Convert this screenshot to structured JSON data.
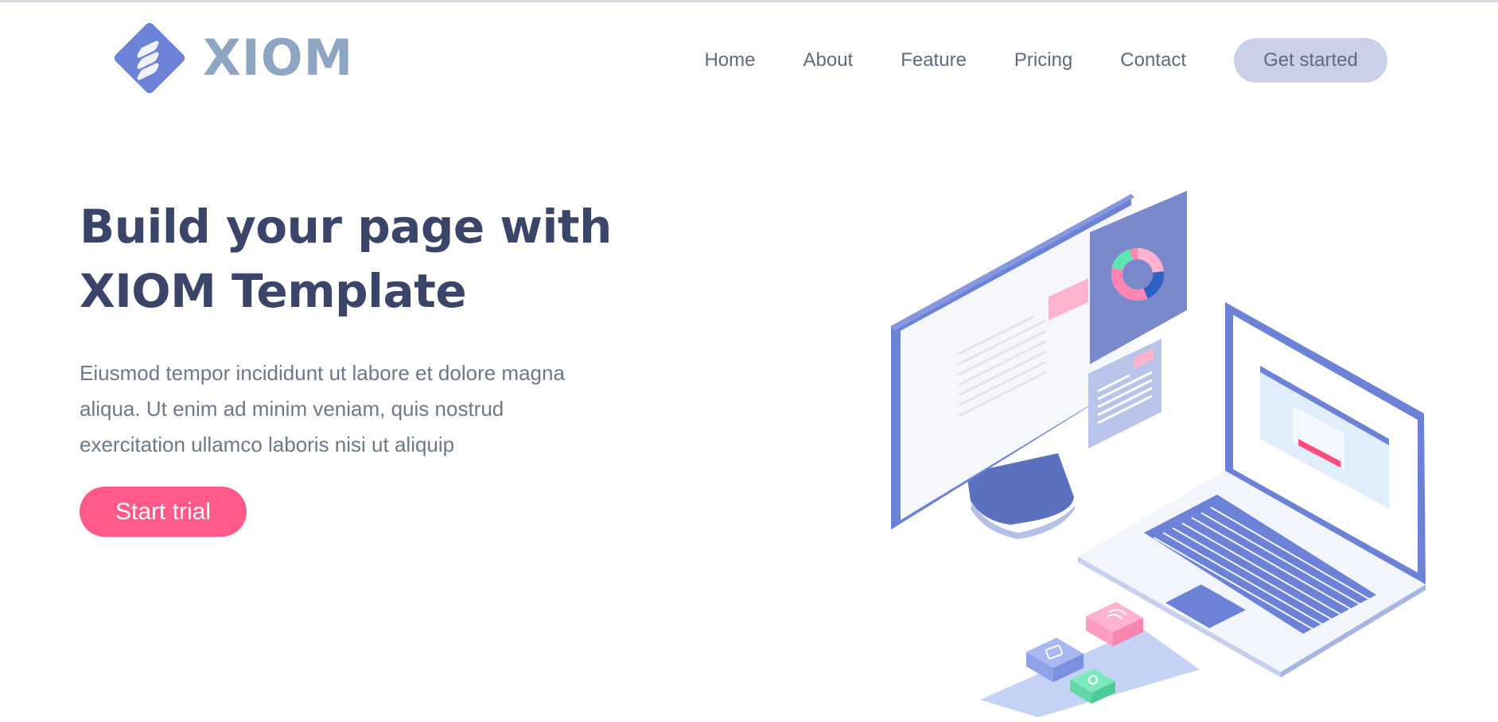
{
  "brand": {
    "name": "XIOM",
    "logo_icon": "diamond-logo-icon",
    "logo_color": "#6c82d6",
    "text_color": "#8ea5c4"
  },
  "nav": {
    "items": [
      {
        "label": "Home"
      },
      {
        "label": "About"
      },
      {
        "label": "Feature"
      },
      {
        "label": "Pricing"
      },
      {
        "label": "Contact"
      }
    ],
    "cta_label": "Get started"
  },
  "hero": {
    "title_line1": "Build your page with",
    "title_line2": "XIOM Template",
    "description_line1": "Eiusmod tempor incididunt ut labore et dolore magna",
    "description_line2": "aliqua. Ut enim ad minim veniam, quis nostrud",
    "description_line3": "exercitation ullamco laboris nisi ut aliquip",
    "button_label": "Start trial"
  },
  "colors": {
    "primary_blue": "#6c82d6",
    "accent_pink": "#ff5a8a",
    "heading": "#3b4569",
    "body_text": "#6d7888",
    "cta_bg": "#c9d0e8"
  },
  "illustration": {
    "icon": "devices-illustration"
  }
}
